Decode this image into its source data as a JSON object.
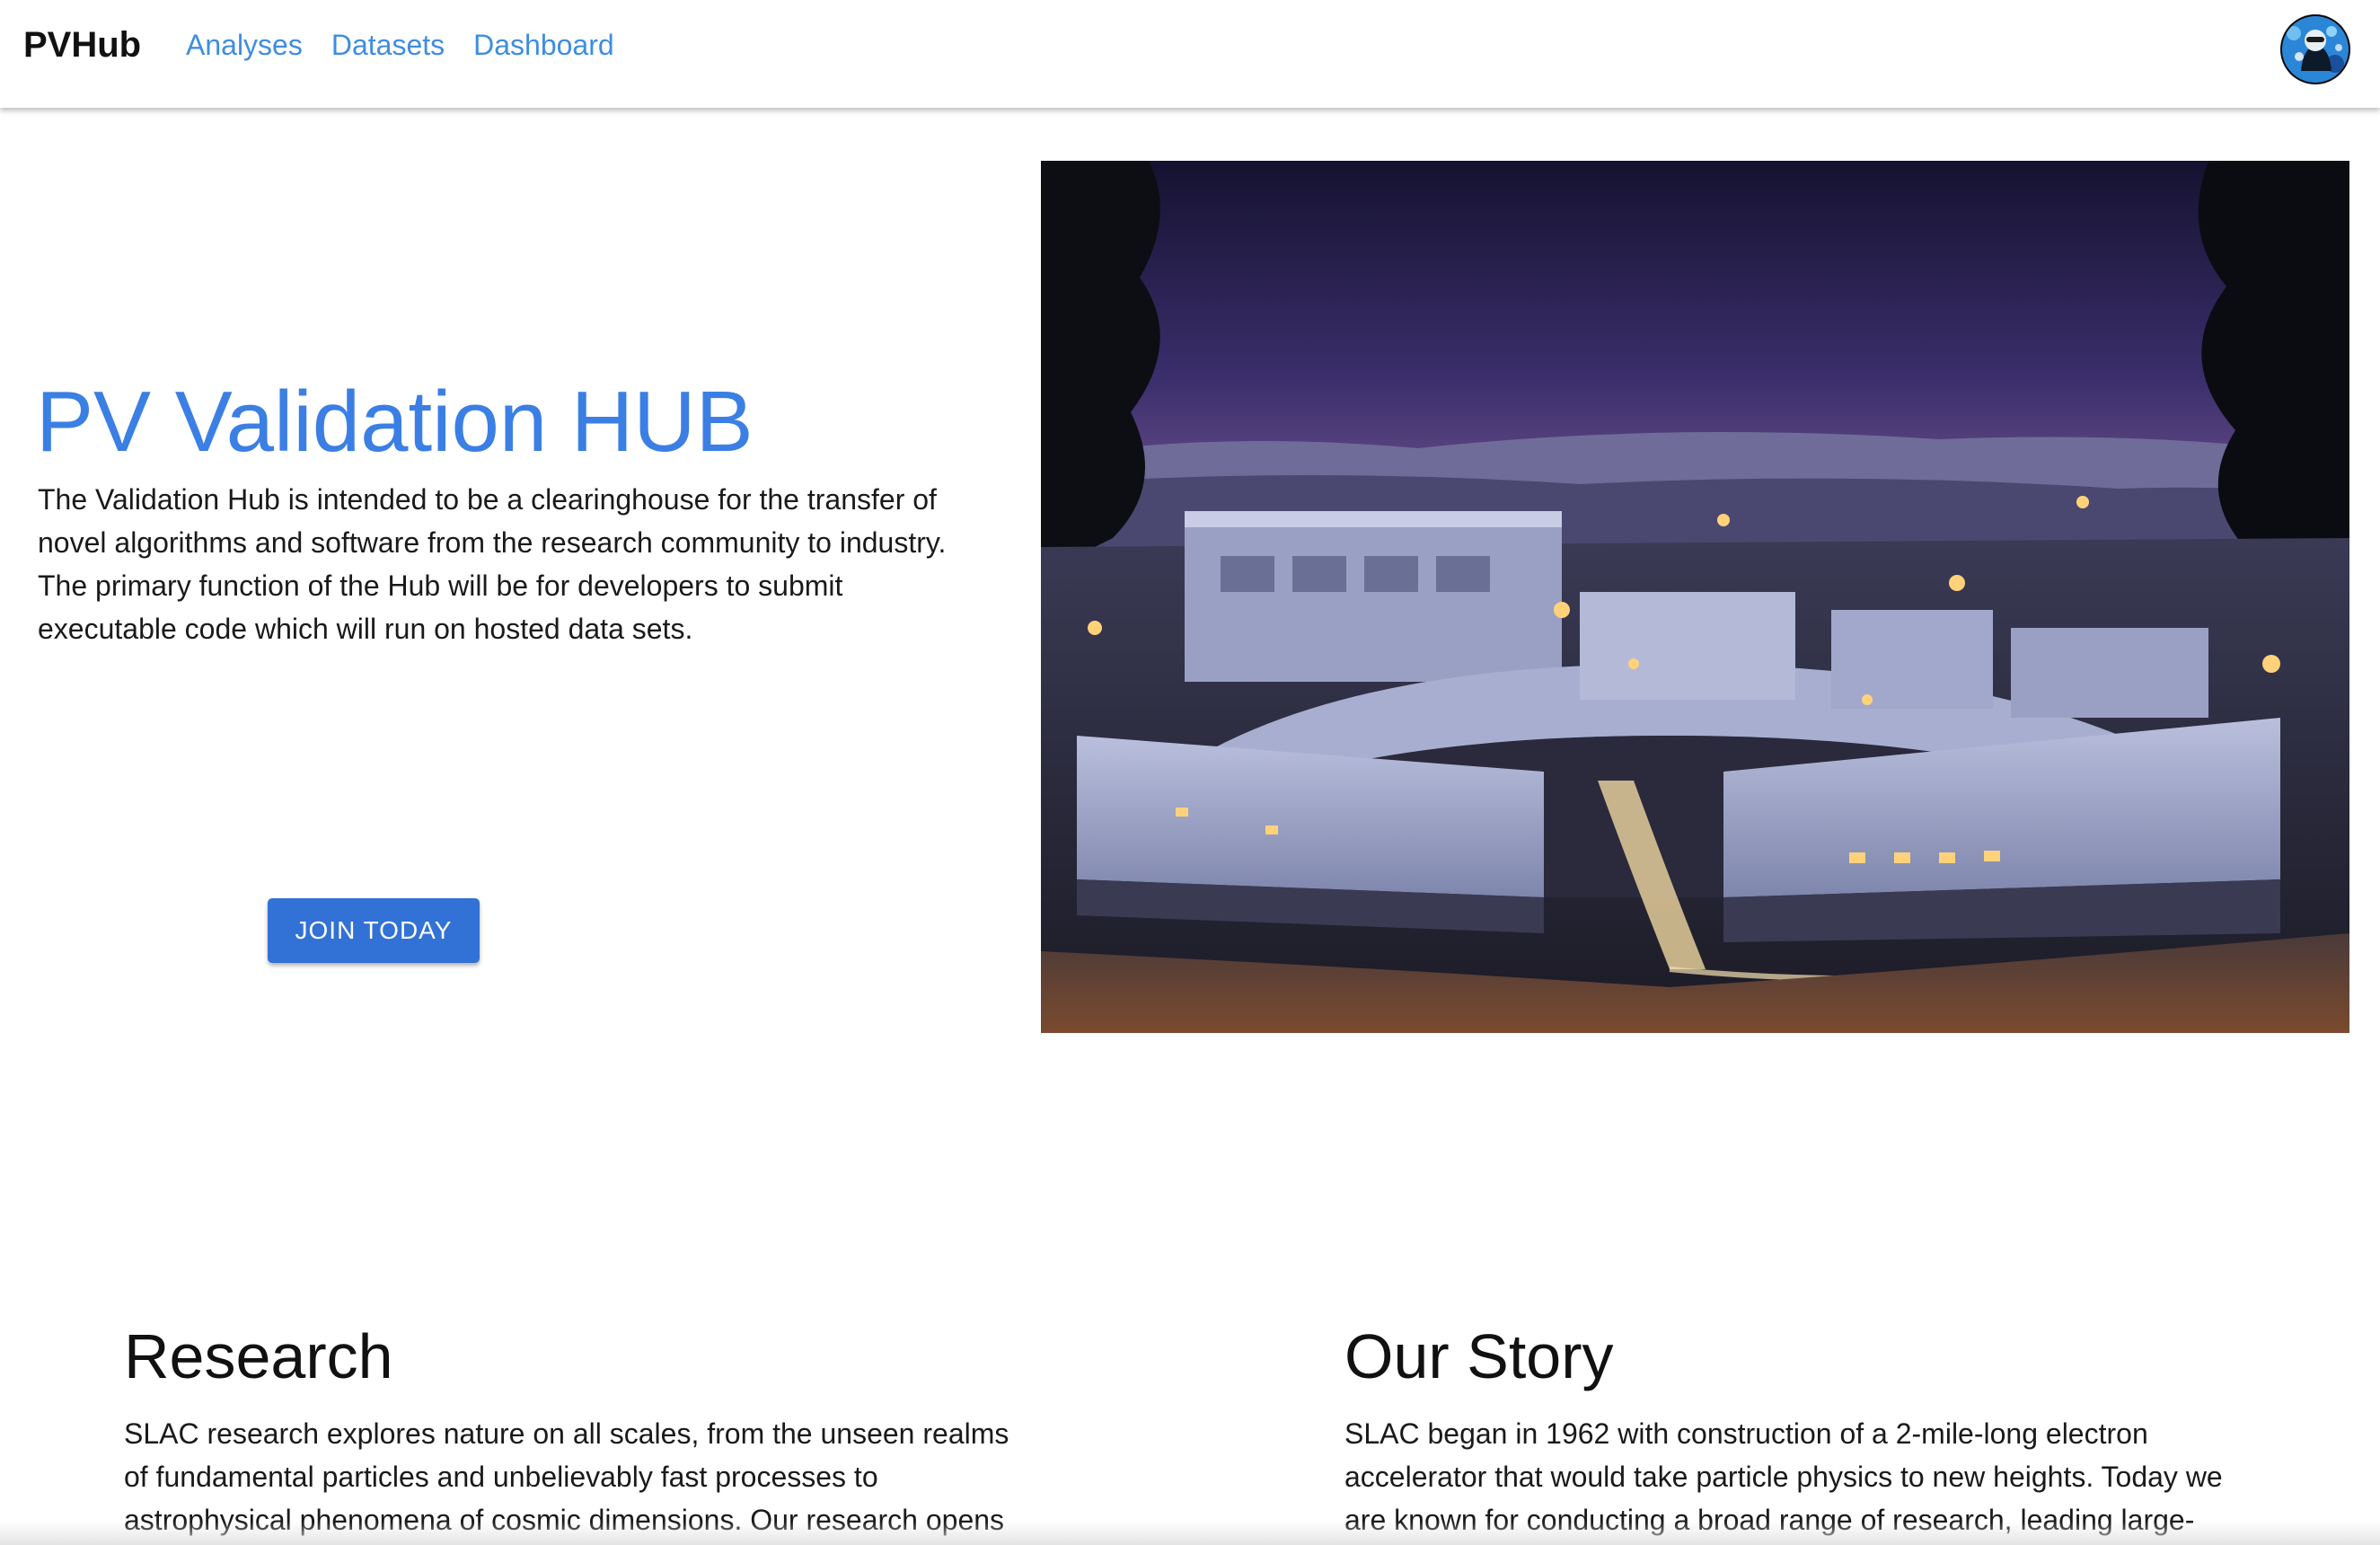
{
  "nav": {
    "brand": "PVHub",
    "links": [
      "Analyses",
      "Datasets",
      "Dashboard"
    ]
  },
  "hero": {
    "title": "PV Validation HUB",
    "description": "The Validation Hub is intended to be a clearinghouse for the transfer of novel algorithms and software from the research community to industry. The primary function of the Hub will be for developers to submit executable code which will run on hosted data sets.",
    "cta_label": "JOIN TODAY",
    "image_icon": "slac-campus-night-photo"
  },
  "sections": {
    "research": {
      "title": "Research",
      "text": "SLAC research explores nature on all scales, from the unseen realms of fundamental particles and unbelievably fast processes to astrophysical phenomena of cosmic dimensions. Our research opens"
    },
    "story": {
      "title": "Our Story",
      "text": "SLAC began in 1962 with construction of a 2-mile-long electron accelerator that would take particle physics to new heights. Today we are known for conducting a broad range of research, leading large-"
    }
  },
  "colors": {
    "accent": "#3b7fe4",
    "link": "#3f8de0",
    "button": "#3271d6"
  }
}
